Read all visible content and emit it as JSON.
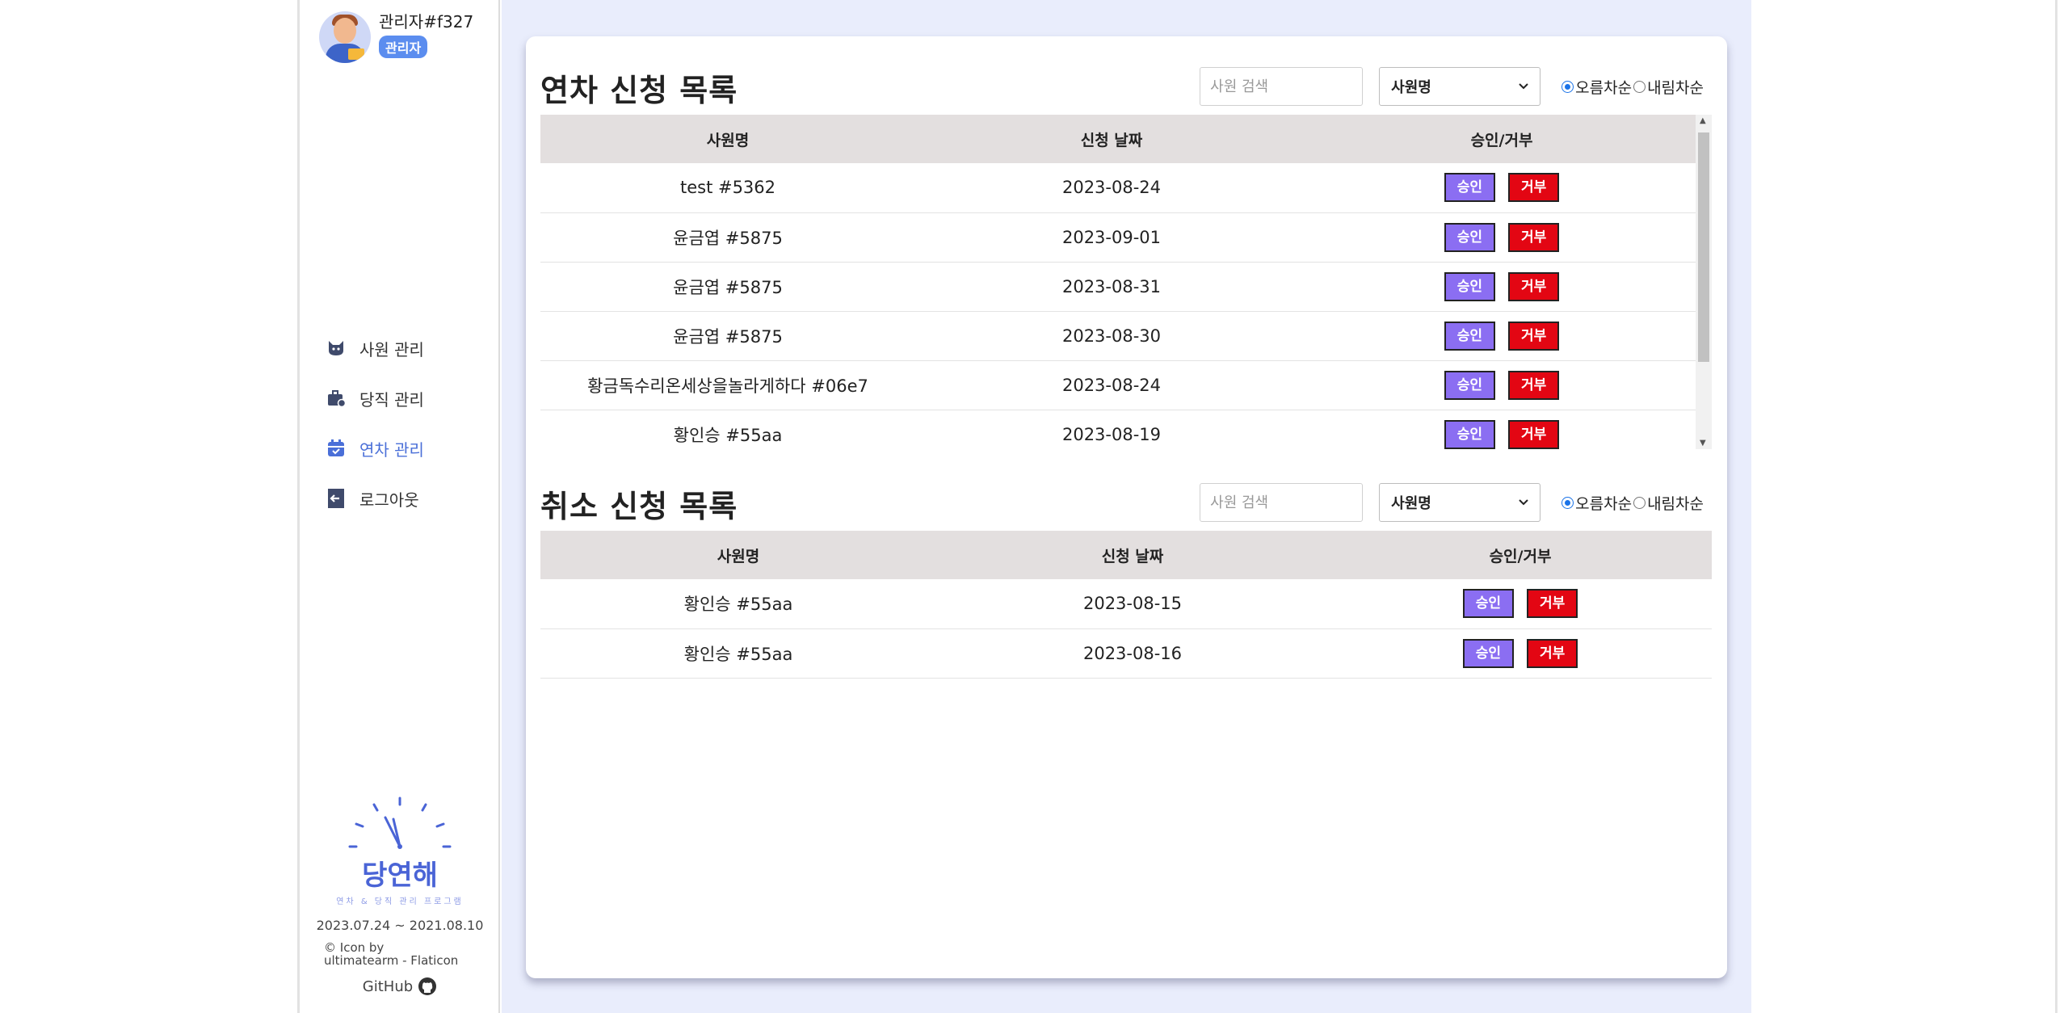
{
  "profile": {
    "name": "관리자#f327",
    "role": "관리자"
  },
  "nav": [
    {
      "label": "사원 관리",
      "icon": "cat-icon"
    },
    {
      "label": "당직 관리",
      "icon": "briefcase-icon"
    },
    {
      "label": "연차 관리",
      "icon": "calendar-icon"
    },
    {
      "label": "로그아웃",
      "icon": "logout-icon"
    }
  ],
  "logo": {
    "name": "당연해",
    "subtitle": "연차 & 당직 관리 프로그램"
  },
  "footer": {
    "dates": "2023.07.24 ~ 2021.08.10",
    "credit_line1": "© Icon by",
    "credit_line2": "ultimatearm - Flaticon",
    "github": "GitHub"
  },
  "annual": {
    "title": "연차 신청 목록",
    "search_placeholder": "사원 검색",
    "sort_select": "사원명",
    "asc_label": "오름차순",
    "desc_label": "내림차순",
    "columns": [
      "사원명",
      "신청 날짜",
      "승인/거부"
    ],
    "rows": [
      {
        "name": "test #5362",
        "date": "2023-08-24"
      },
      {
        "name": "윤금엽 #5875",
        "date": "2023-09-01"
      },
      {
        "name": "윤금엽 #5875",
        "date": "2023-08-31"
      },
      {
        "name": "윤금엽 #5875",
        "date": "2023-08-30"
      },
      {
        "name": "황금독수리온세상을놀라게하다 #06e7",
        "date": "2023-08-24"
      },
      {
        "name": "황인승 #55aa",
        "date": "2023-08-19"
      }
    ],
    "approve_label": "승인",
    "reject_label": "거부"
  },
  "cancel": {
    "title": "취소 신청 목록",
    "search_placeholder": "사원 검색",
    "sort_select": "사원명",
    "asc_label": "오름차순",
    "desc_label": "내림차순",
    "columns": [
      "사원명",
      "신청 날짜",
      "승인/거부"
    ],
    "rows": [
      {
        "name": "황인승 #55aa",
        "date": "2023-08-15"
      },
      {
        "name": "황인승 #55aa",
        "date": "2023-08-16"
      }
    ],
    "approve_label": "승인",
    "reject_label": "거부"
  },
  "colors": {
    "accent": "#4a6fd8",
    "approve": "#8b6ef2",
    "reject": "#e30613",
    "main_bg": "#e9edfc"
  }
}
